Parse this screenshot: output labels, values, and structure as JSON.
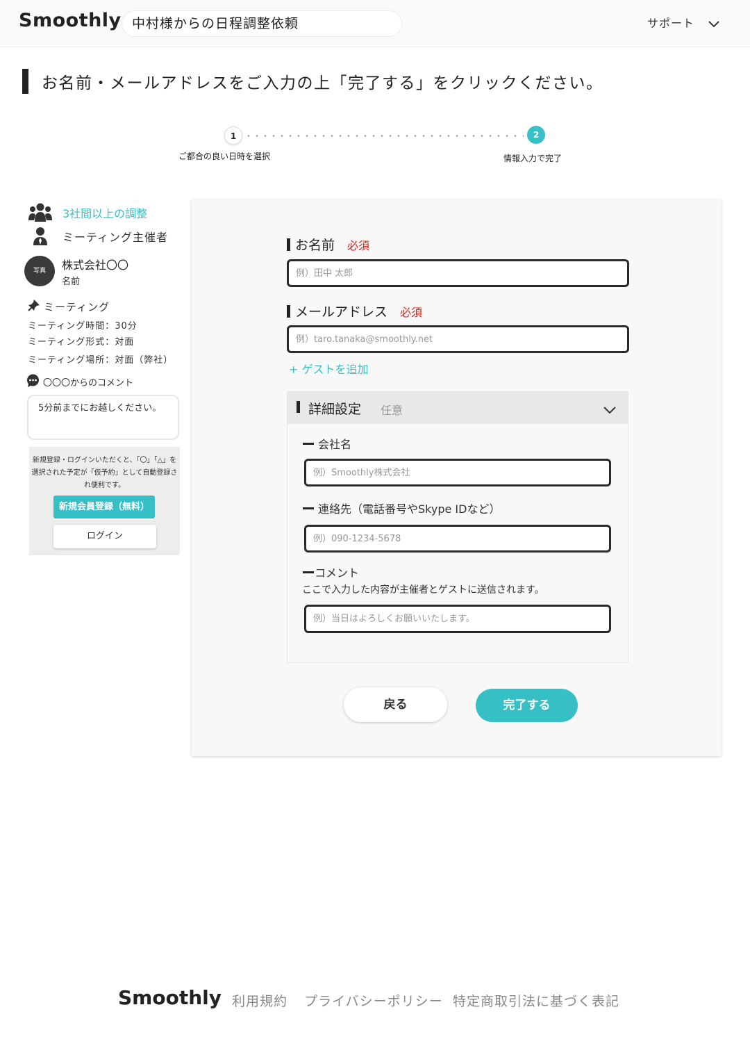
{
  "header": {
    "logo": "Smoothly",
    "title": "中村様からの日程調整依頼",
    "support_label": "サポート"
  },
  "instruction": "お名前・メールアドレスをご入力の上「完了する」をクリックください。",
  "stepper": {
    "steps": [
      {
        "number": "1",
        "label": "ご都合の良い日時を選択"
      },
      {
        "number": "2",
        "label": "情報入力で完了"
      }
    ],
    "current_step": 2
  },
  "sidebar": {
    "multi_company": "3社間以上の調整",
    "host_label": "ミーティング主催者",
    "avatar_text": "写真",
    "company": "株式会社〇〇",
    "person": "名前",
    "meeting_heading": "ミーティング",
    "meeting_time": "ミーティング時間：30分",
    "meeting_format": "ミーティング形式：対面",
    "meeting_place": "ミーティング場所：対面（弊社）",
    "comment_heading": "〇〇〇からのコメント",
    "comment_text": "5分前までにお越しください。",
    "login_note": "新規登録・ログインいただくと、「〇」「△」を選択された予定が「仮予約」として自動登録され便利です。",
    "register_button": "新規会員登録（無料）",
    "login_button": "ログイン"
  },
  "form": {
    "name": {
      "label": "お名前",
      "required": "必須",
      "placeholder": "例）田中 太郎"
    },
    "email": {
      "label": "メールアドレス",
      "required": "必須",
      "placeholder": "例）taro.tanaka@smoothly.net"
    },
    "add_guest": "+ ゲストを追加",
    "details": {
      "title": "詳細設定",
      "optional": "任意",
      "company": {
        "label": "会社名",
        "placeholder": "例）Smoothly株式会社"
      },
      "contact": {
        "label": "連絡先（電話番号やSkype IDなど）",
        "placeholder": "例）090-1234-5678"
      },
      "comment": {
        "label": "コメント",
        "note": "ここで入力した内容が主催者とゲストに送信されます。",
        "placeholder": "例）当日はよろしくお願いいたします。"
      }
    },
    "back_button": "戻る",
    "submit_button": "完了する"
  },
  "footer": {
    "logo": "Smoothly",
    "links": [
      "利用規約",
      "プライバシーポリシー",
      "特定商取引法に基づく表記"
    ]
  },
  "colors": {
    "accent": "#36bfc4",
    "required": "#e0200f",
    "dark": "#222222"
  }
}
